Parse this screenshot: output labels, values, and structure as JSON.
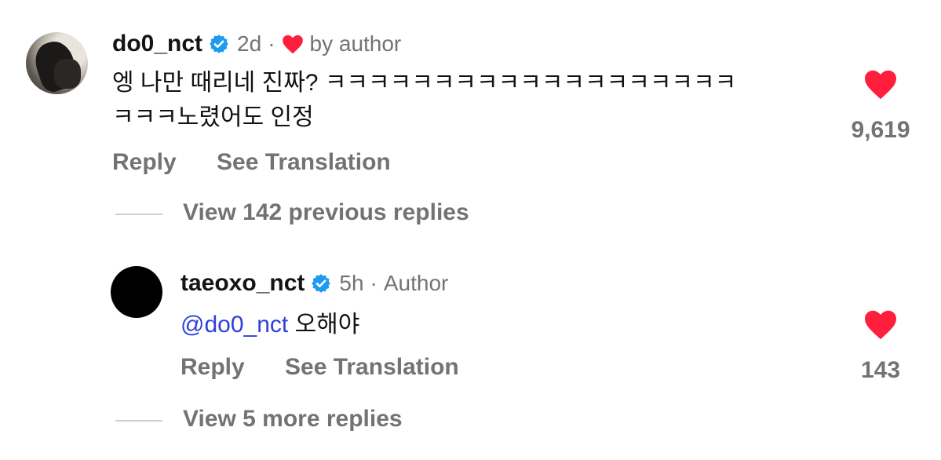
{
  "comment": {
    "username": "do0_nct",
    "time": "2d",
    "dot": "·",
    "liked_by": "by author",
    "text_line1": "엥 나만 때리네 진짜? ㅋㅋㅋㅋㅋㅋㅋㅋㅋㅋㅋㅋㅋㅋㅋㅋㅋㅋㅋ",
    "text_line2": "ㅋㅋㅋ노렸어도 인정",
    "likes": "9,619",
    "reply_label": "Reply",
    "translate_label": "See Translation",
    "view_previous": "View 142 previous replies"
  },
  "reply": {
    "username": "taeoxo_nct",
    "time": "5h",
    "dot": "·",
    "role": "Author",
    "mention": "@do0_nct",
    "text": "오해야",
    "likes": "143",
    "reply_label": "Reply",
    "translate_label": "See Translation",
    "view_more": "View 5 more replies"
  },
  "colors": {
    "heart": "#ff1f3d",
    "verified": "#1d9bf0",
    "mention": "#2F3FDB",
    "muted": "#737373"
  },
  "icons": {
    "verified": "verified-badge-icon",
    "heart": "heart-icon"
  }
}
